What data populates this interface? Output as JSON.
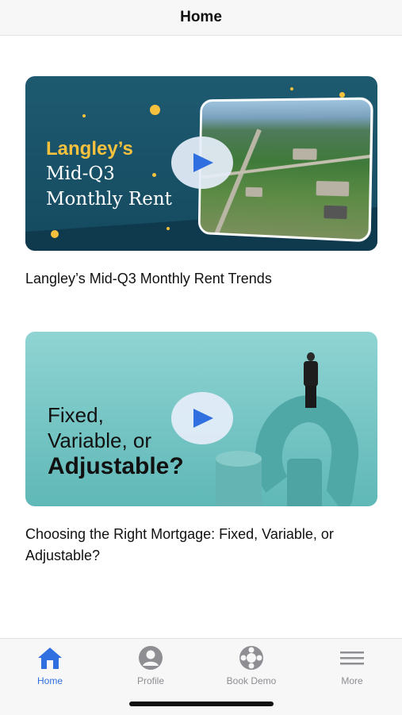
{
  "header": {
    "title": "Home"
  },
  "videos": [
    {
      "title": "Langley’s Mid-Q3 Monthly Rent Trends",
      "thumbnail_text": [
        "Langley’s",
        "Mid-Q3",
        "Monthly Rent"
      ]
    },
    {
      "title": "Choosing the Right Mortgage: Fixed, Variable, or Adjustable?",
      "thumbnail_text": [
        "Fixed,",
        "Variable, or",
        "Adjustable?"
      ]
    }
  ],
  "tabs": [
    {
      "label": "Home",
      "icon": "home-icon",
      "active": true
    },
    {
      "label": "Profile",
      "icon": "profile-icon",
      "active": false
    },
    {
      "label": "Book Demo",
      "icon": "lifebuoy-icon",
      "active": false
    },
    {
      "label": "More",
      "icon": "menu-icon",
      "active": false
    }
  ],
  "colors": {
    "accent": "#2f6fe0",
    "inactive": "#8e8e93",
    "rent_gold": "#f6c23e"
  }
}
